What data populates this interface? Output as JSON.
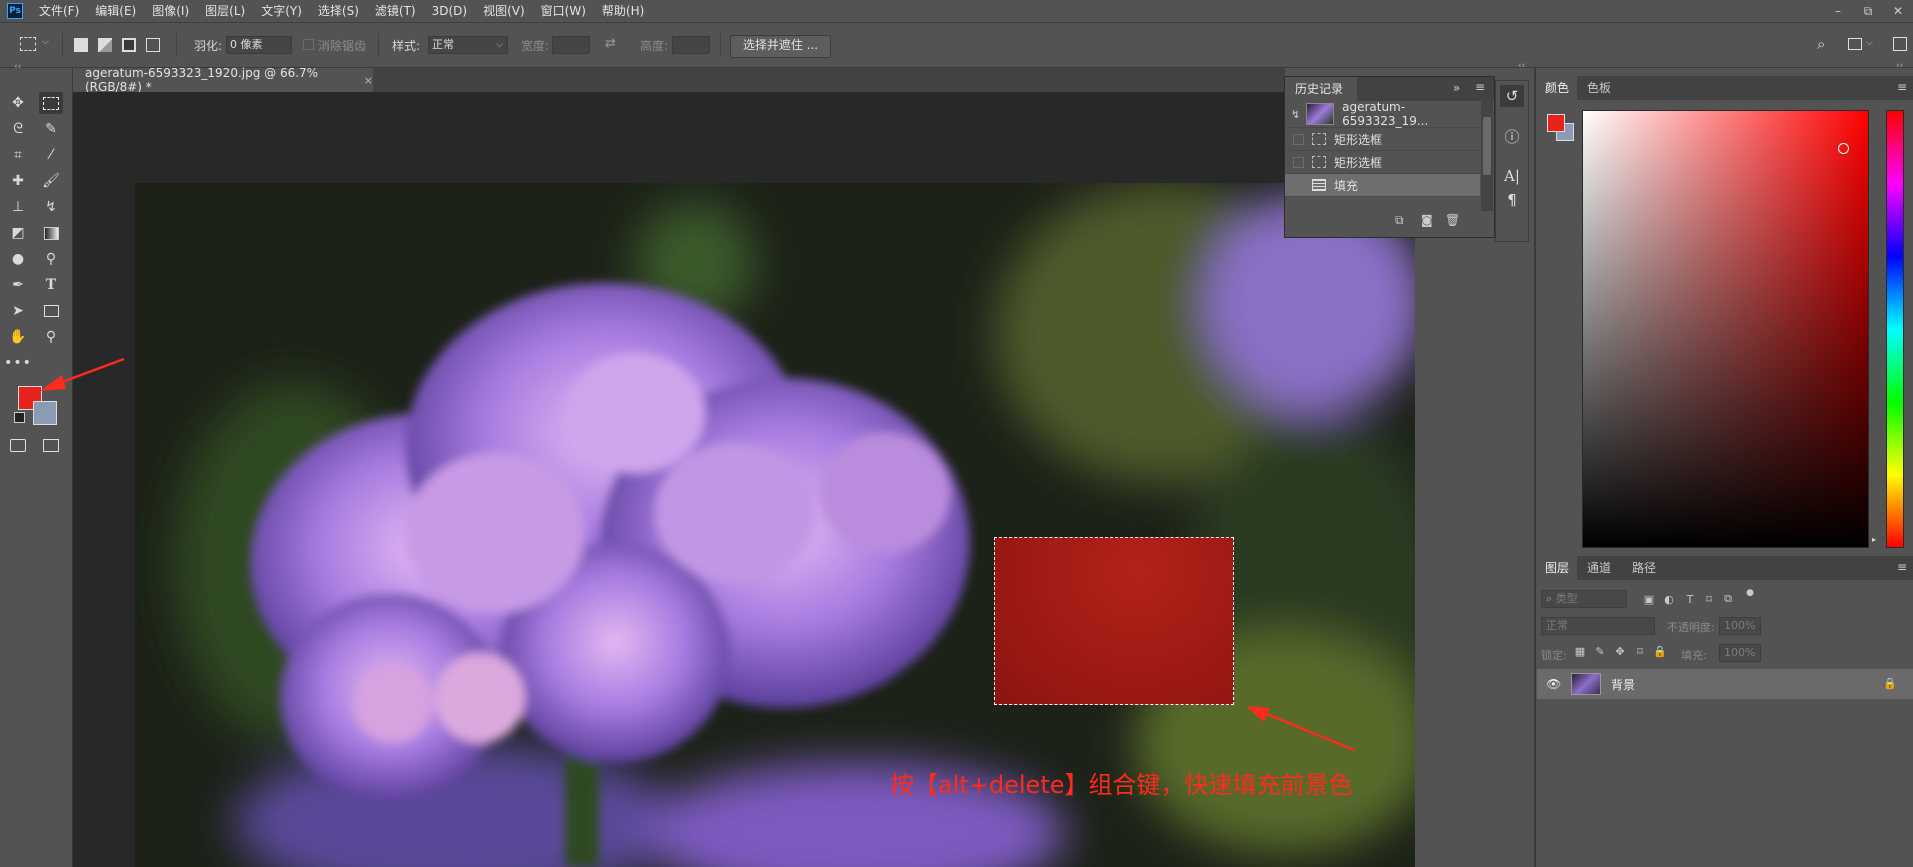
{
  "app": {
    "logo": "Ps"
  },
  "menubar": {
    "items": [
      "文件(F)",
      "编辑(E)",
      "图像(I)",
      "图层(L)",
      "文字(Y)",
      "选择(S)",
      "滤镜(T)",
      "3D(D)",
      "视图(V)",
      "窗口(W)",
      "帮助(H)"
    ]
  },
  "window_controls": {
    "minimize": "–",
    "restore": "⧉",
    "close": "✕"
  },
  "options_bar": {
    "feather_label": "羽化:",
    "feather_value": "0 像素",
    "antialias_label": "消除锯齿",
    "style_label": "样式:",
    "style_value": "正常",
    "width_label": "宽度:",
    "height_label": "高度:",
    "mask_button": "选择并遮住 ..."
  },
  "document": {
    "tab_title": "ageratum-6593323_1920.jpg @ 66.7%(RGB/8#) *",
    "close_glyph": "×",
    "annotation": "按【alt+delete】组合键，快速填充前景色"
  },
  "colors": {
    "foreground": "#e8221c",
    "background": "#8a9cb3",
    "annotation": "#ff2b1c"
  },
  "history_panel": {
    "title": "历史记录",
    "snapshot_name": "ageratum-6593323_19...",
    "steps": [
      "矩形选框",
      "矩形选框",
      "填充"
    ],
    "selected_step": "填充"
  },
  "color_panel": {
    "tabs": [
      "颜色",
      "色板"
    ],
    "active_tab": "颜色"
  },
  "layers_panel": {
    "tabs": [
      "图层",
      "通道",
      "路径"
    ],
    "active_tab": "图层",
    "filter_placeholder": "类型",
    "blend_mode": "正常",
    "opacity_label": "不透明度:",
    "opacity_value": "100%",
    "lock_label": "锁定:",
    "fill_label": "填充:",
    "fill_value": "100%",
    "layers": [
      {
        "name": "背景",
        "visible": true,
        "locked": true
      }
    ]
  }
}
